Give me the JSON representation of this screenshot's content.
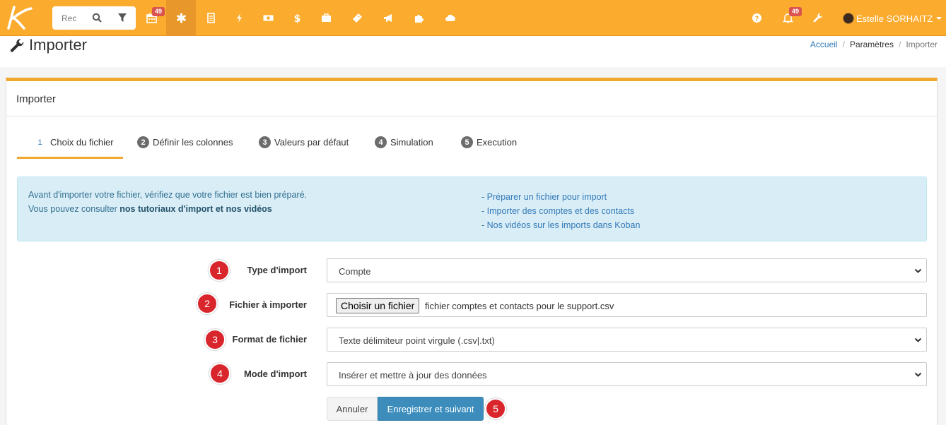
{
  "topbar": {
    "search_text": "Rec",
    "calendar_badge": "49",
    "notifications_badge": "49",
    "user_name": "Estelle SORHAITZ",
    "colors": {
      "bar": "#fbac2f",
      "badge": "#d9534f"
    }
  },
  "page": {
    "title": "Importer",
    "breadcrumb": [
      "Accueil",
      "Paramètres",
      "Importer"
    ]
  },
  "panel": {
    "title": "Importer",
    "tabs": [
      {
        "num": "1",
        "label": "Choix du fichier"
      },
      {
        "num": "2",
        "label": "Définir les colonnes"
      },
      {
        "num": "3",
        "label": "Valeurs par défaut"
      },
      {
        "num": "4",
        "label": "Simulation"
      },
      {
        "num": "5",
        "label": "Execution"
      }
    ]
  },
  "alert": {
    "line1": "Avant d'importer votre fichier, vérifiez que votre fichier est bien préparé.",
    "line2_prefix": "Vous pouvez consulter ",
    "line2_bold": "nos tutoriaux d'import et nos vidéos",
    "links": [
      "Préparer un fichier pour import",
      "Importer des comptes et des contacts",
      "Nos vidéos sur les imports dans Koban"
    ]
  },
  "form": {
    "type_import": {
      "step": "1",
      "label": "Type d'import",
      "value": "Compte"
    },
    "fichier": {
      "step": "2",
      "label": "Fichier à importer",
      "button": "Choisir un fichier",
      "filename": "fichier comptes et contacts pour le support.csv"
    },
    "format": {
      "step": "3",
      "label": "Format de fichier",
      "value": "Texte délimiteur point virgule (.csv|.txt)"
    },
    "mode": {
      "step": "4",
      "label": "Mode d'import",
      "value": "Insérer et mettre à jour des données"
    },
    "cancel_label": "Annuler",
    "save_label": "Enregistrer et suivant",
    "save_step": "5"
  }
}
